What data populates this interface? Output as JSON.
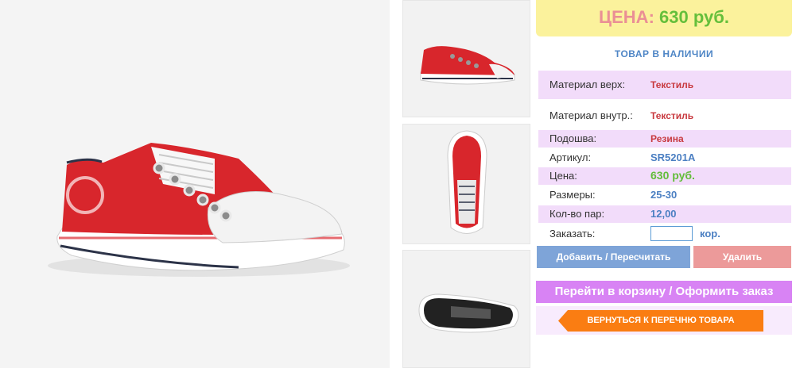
{
  "price": {
    "label": "ЦЕНА:",
    "value": "630 руб."
  },
  "stock": "ТОВАР В НАЛИЧИИ",
  "details": [
    {
      "key": "Материал верх:",
      "value": "Текстиль"
    },
    {
      "key": "Материал внутр.:",
      "value": "Текстиль"
    },
    {
      "key": "Подошва:",
      "value": "Резина"
    },
    {
      "key": "Артикул:",
      "value": "SR5201A"
    },
    {
      "key": "Цена:",
      "value": "630 руб."
    },
    {
      "key": "Размеры:",
      "value": "25-30"
    },
    {
      "key": "Кол-во пар:",
      "value": "12,00"
    }
  ],
  "order": {
    "label": "Заказать:",
    "value": "",
    "unit": "кор."
  },
  "buttons": {
    "add": "Добавить / Пересчитать",
    "delete": "Удалить",
    "cart": "Перейти в корзину / Оформить заказ",
    "back": "ВЕРНУТЬСЯ К ПЕРЕЧНЮ ТОВАРА"
  },
  "colors": {
    "shoe_red": "#d8262c",
    "price_label": "#ea8f95",
    "price_value": "#65bf3b",
    "link_blue": "#4b7fc2",
    "accent_orange": "#fa7d12",
    "cart_purple": "#d883f4"
  }
}
